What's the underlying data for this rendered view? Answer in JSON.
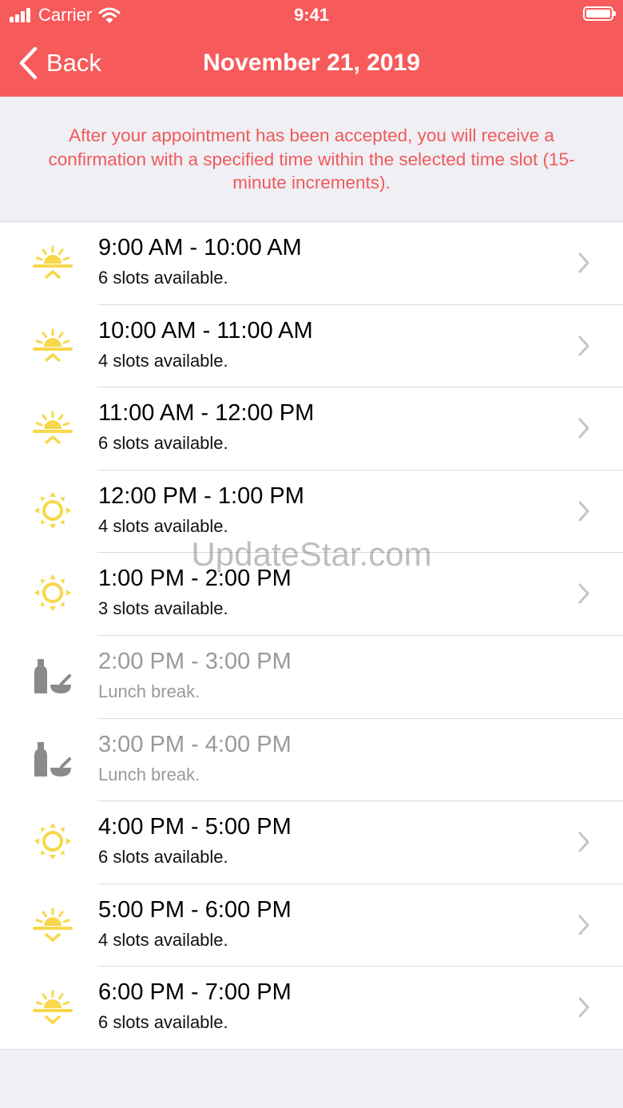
{
  "status_bar": {
    "carrier": "Carrier",
    "time": "9:41"
  },
  "nav": {
    "back_label": "Back",
    "title": "November 21, 2019"
  },
  "notice": "After your appointment has been accepted, you will receive a confirmation with a specified time within the selected time slot (15-minute increments).",
  "colors": {
    "accent": "#f75a5a",
    "notice_text": "#f05a5a",
    "icon_yellow": "#f7d84a",
    "icon_gray": "#8a8a8a"
  },
  "slots": [
    {
      "time": "9:00 AM - 10:00 AM",
      "status": "6 slots available.",
      "icon": "sunrise-icon",
      "available": true
    },
    {
      "time": "10:00 AM - 11:00 AM",
      "status": "4 slots available.",
      "icon": "sunrise-icon",
      "available": true
    },
    {
      "time": "11:00 AM - 12:00 PM",
      "status": "6 slots available.",
      "icon": "sunrise-icon",
      "available": true
    },
    {
      "time": "12:00 PM - 1:00 PM",
      "status": "4 slots available.",
      "icon": "sun-icon",
      "available": true
    },
    {
      "time": "1:00 PM - 2:00 PM",
      "status": "3 slots available.",
      "icon": "sun-icon",
      "available": true
    },
    {
      "time": "2:00 PM - 3:00 PM",
      "status": "Lunch break.",
      "icon": "lunch-icon",
      "available": false
    },
    {
      "time": "3:00 PM - 4:00 PM",
      "status": "Lunch break.",
      "icon": "lunch-icon",
      "available": false
    },
    {
      "time": "4:00 PM - 5:00 PM",
      "status": "6 slots available.",
      "icon": "sun-icon",
      "available": true
    },
    {
      "time": "5:00 PM - 6:00 PM",
      "status": "4 slots available.",
      "icon": "sunset-icon",
      "available": true
    },
    {
      "time": "6:00 PM - 7:00 PM",
      "status": "6 slots available.",
      "icon": "sunset-icon",
      "available": true
    }
  ],
  "watermark": "UpdateStar.com"
}
